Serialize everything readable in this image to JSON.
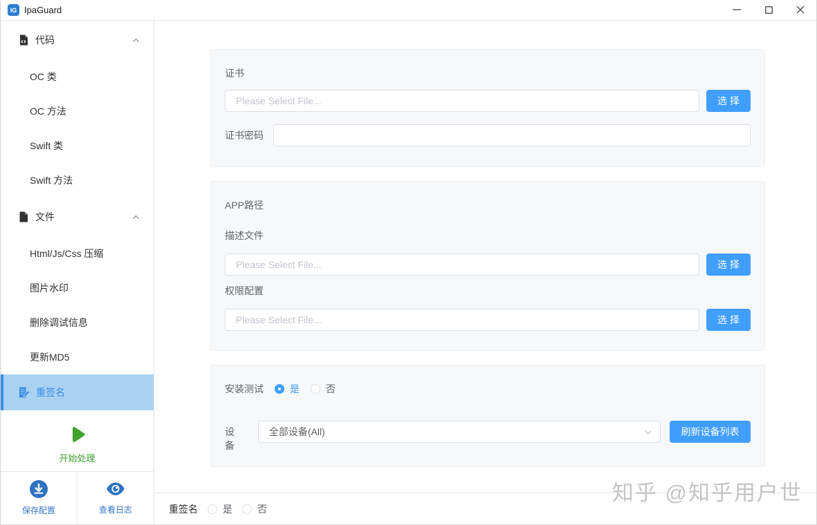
{
  "window": {
    "title": "IpaGuard",
    "logo_text": "IG"
  },
  "sidebar": {
    "groups": [
      {
        "label": "代码",
        "items": [
          "OC 类",
          "OC 方法",
          "Swift 类",
          "Swift 方法"
        ]
      },
      {
        "label": "文件",
        "items": [
          "Html/Js/Css 压缩",
          "图片水印",
          "删除调试信息",
          "更新MD5"
        ]
      }
    ],
    "selected_item": "重签名",
    "start_label": "开始处理",
    "save_config_label": "保存配置",
    "view_log_label": "查看日志"
  },
  "form": {
    "cert": {
      "label": "证书",
      "placeholder": "Please Select File...",
      "select_button": "选 择",
      "password_label": "证书密码",
      "password_value": ""
    },
    "app": {
      "title": "APP路径",
      "profile_label": "描述文件",
      "profile_placeholder": "Please Select File...",
      "profile_select_button": "选 择",
      "entitlement_label": "权限配置",
      "entitlement_placeholder": "Please Select File...",
      "entitlement_select_button": "选 择"
    },
    "install": {
      "label": "安装测试",
      "yes": "是",
      "no": "否",
      "selected": "是",
      "device_label": "设备",
      "device_value": "全部设备(All)",
      "refresh_button": "刷新设备列表"
    },
    "resign": {
      "label": "重签名",
      "yes": "是",
      "no": "否",
      "selected": ""
    }
  },
  "watermark": "知乎 @知乎用户世",
  "colors": {
    "primary": "#409eff",
    "sidebar_selected_bg": "#a9d2f1",
    "sidebar_selected_accent": "#3a8ee6",
    "start_green": "#3fa32c",
    "footer_icon_blue": "#2f72c2",
    "watermark_gray": "#c4c4c4"
  }
}
